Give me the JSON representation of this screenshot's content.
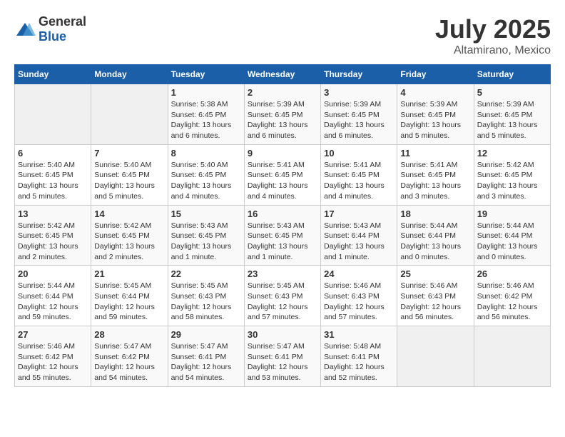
{
  "header": {
    "logo_general": "General",
    "logo_blue": "Blue",
    "title": "July 2025",
    "location": "Altamirano, Mexico"
  },
  "weekdays": [
    "Sunday",
    "Monday",
    "Tuesday",
    "Wednesday",
    "Thursday",
    "Friday",
    "Saturday"
  ],
  "weeks": [
    [
      {
        "day": "",
        "info": ""
      },
      {
        "day": "",
        "info": ""
      },
      {
        "day": "1",
        "info": "Sunrise: 5:38 AM\nSunset: 6:45 PM\nDaylight: 13 hours and 6 minutes."
      },
      {
        "day": "2",
        "info": "Sunrise: 5:39 AM\nSunset: 6:45 PM\nDaylight: 13 hours and 6 minutes."
      },
      {
        "day": "3",
        "info": "Sunrise: 5:39 AM\nSunset: 6:45 PM\nDaylight: 13 hours and 6 minutes."
      },
      {
        "day": "4",
        "info": "Sunrise: 5:39 AM\nSunset: 6:45 PM\nDaylight: 13 hours and 5 minutes."
      },
      {
        "day": "5",
        "info": "Sunrise: 5:39 AM\nSunset: 6:45 PM\nDaylight: 13 hours and 5 minutes."
      }
    ],
    [
      {
        "day": "6",
        "info": "Sunrise: 5:40 AM\nSunset: 6:45 PM\nDaylight: 13 hours and 5 minutes."
      },
      {
        "day": "7",
        "info": "Sunrise: 5:40 AM\nSunset: 6:45 PM\nDaylight: 13 hours and 5 minutes."
      },
      {
        "day": "8",
        "info": "Sunrise: 5:40 AM\nSunset: 6:45 PM\nDaylight: 13 hours and 4 minutes."
      },
      {
        "day": "9",
        "info": "Sunrise: 5:41 AM\nSunset: 6:45 PM\nDaylight: 13 hours and 4 minutes."
      },
      {
        "day": "10",
        "info": "Sunrise: 5:41 AM\nSunset: 6:45 PM\nDaylight: 13 hours and 4 minutes."
      },
      {
        "day": "11",
        "info": "Sunrise: 5:41 AM\nSunset: 6:45 PM\nDaylight: 13 hours and 3 minutes."
      },
      {
        "day": "12",
        "info": "Sunrise: 5:42 AM\nSunset: 6:45 PM\nDaylight: 13 hours and 3 minutes."
      }
    ],
    [
      {
        "day": "13",
        "info": "Sunrise: 5:42 AM\nSunset: 6:45 PM\nDaylight: 13 hours and 2 minutes."
      },
      {
        "day": "14",
        "info": "Sunrise: 5:42 AM\nSunset: 6:45 PM\nDaylight: 13 hours and 2 minutes."
      },
      {
        "day": "15",
        "info": "Sunrise: 5:43 AM\nSunset: 6:45 PM\nDaylight: 13 hours and 1 minute."
      },
      {
        "day": "16",
        "info": "Sunrise: 5:43 AM\nSunset: 6:45 PM\nDaylight: 13 hours and 1 minute."
      },
      {
        "day": "17",
        "info": "Sunrise: 5:43 AM\nSunset: 6:44 PM\nDaylight: 13 hours and 1 minute."
      },
      {
        "day": "18",
        "info": "Sunrise: 5:44 AM\nSunset: 6:44 PM\nDaylight: 13 hours and 0 minutes."
      },
      {
        "day": "19",
        "info": "Sunrise: 5:44 AM\nSunset: 6:44 PM\nDaylight: 13 hours and 0 minutes."
      }
    ],
    [
      {
        "day": "20",
        "info": "Sunrise: 5:44 AM\nSunset: 6:44 PM\nDaylight: 12 hours and 59 minutes."
      },
      {
        "day": "21",
        "info": "Sunrise: 5:45 AM\nSunset: 6:44 PM\nDaylight: 12 hours and 59 minutes."
      },
      {
        "day": "22",
        "info": "Sunrise: 5:45 AM\nSunset: 6:43 PM\nDaylight: 12 hours and 58 minutes."
      },
      {
        "day": "23",
        "info": "Sunrise: 5:45 AM\nSunset: 6:43 PM\nDaylight: 12 hours and 57 minutes."
      },
      {
        "day": "24",
        "info": "Sunrise: 5:46 AM\nSunset: 6:43 PM\nDaylight: 12 hours and 57 minutes."
      },
      {
        "day": "25",
        "info": "Sunrise: 5:46 AM\nSunset: 6:43 PM\nDaylight: 12 hours and 56 minutes."
      },
      {
        "day": "26",
        "info": "Sunrise: 5:46 AM\nSunset: 6:42 PM\nDaylight: 12 hours and 56 minutes."
      }
    ],
    [
      {
        "day": "27",
        "info": "Sunrise: 5:46 AM\nSunset: 6:42 PM\nDaylight: 12 hours and 55 minutes."
      },
      {
        "day": "28",
        "info": "Sunrise: 5:47 AM\nSunset: 6:42 PM\nDaylight: 12 hours and 54 minutes."
      },
      {
        "day": "29",
        "info": "Sunrise: 5:47 AM\nSunset: 6:41 PM\nDaylight: 12 hours and 54 minutes."
      },
      {
        "day": "30",
        "info": "Sunrise: 5:47 AM\nSunset: 6:41 PM\nDaylight: 12 hours and 53 minutes."
      },
      {
        "day": "31",
        "info": "Sunrise: 5:48 AM\nSunset: 6:41 PM\nDaylight: 12 hours and 52 minutes."
      },
      {
        "day": "",
        "info": ""
      },
      {
        "day": "",
        "info": ""
      }
    ]
  ]
}
